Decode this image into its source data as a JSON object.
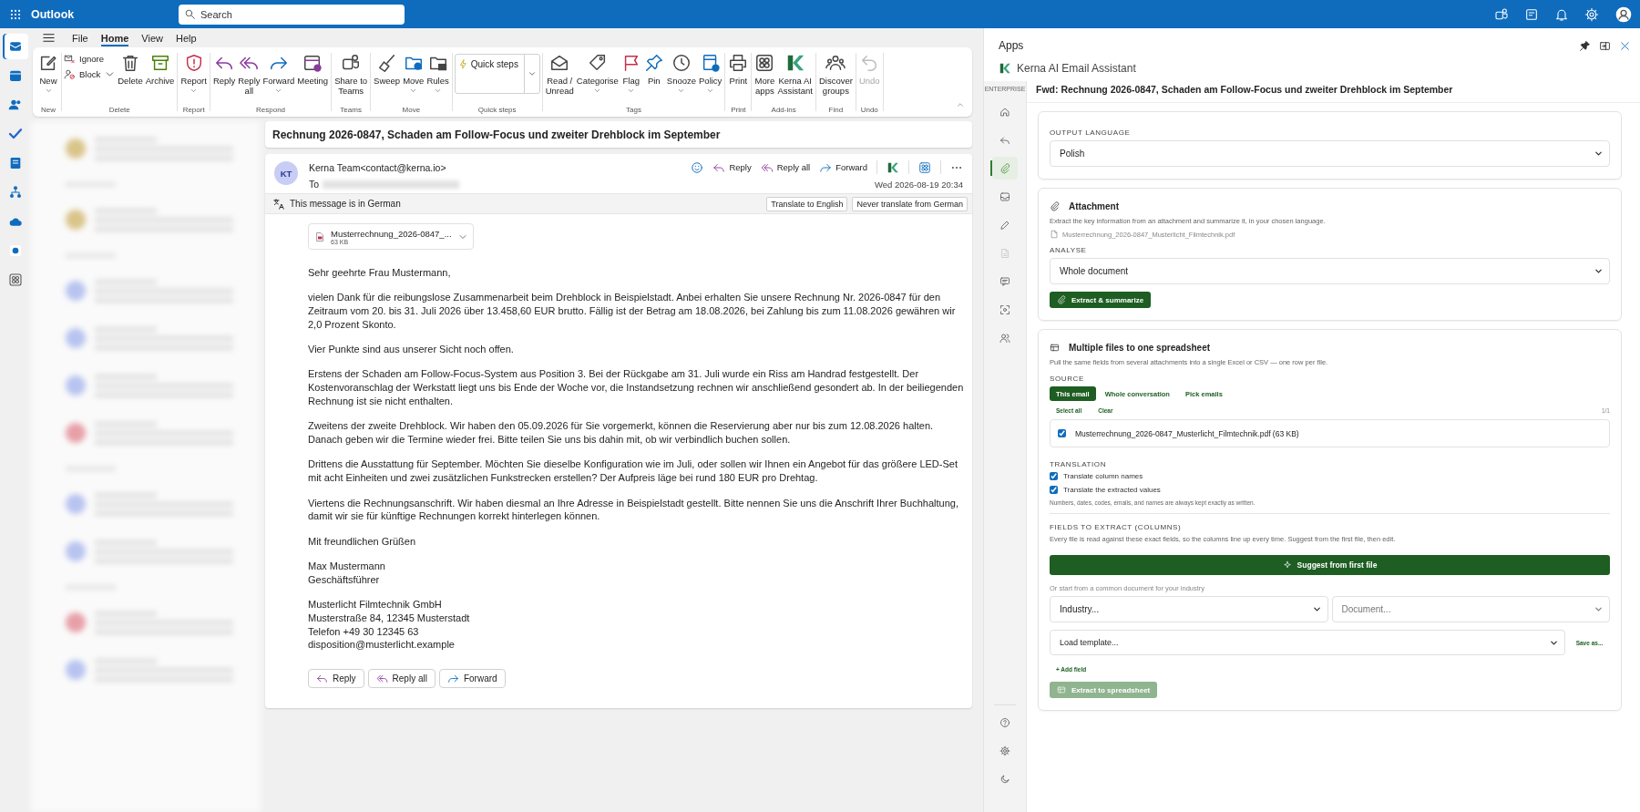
{
  "top_bar": {
    "app_name": "Outlook",
    "search": {
      "placeholder": "Search"
    }
  },
  "app_rail": [
    {
      "selected": true
    },
    {
      "selected": false
    },
    {
      "selected": false
    },
    {
      "selected": false
    },
    {
      "selected": false
    },
    {
      "selected": false
    },
    {
      "selected": false
    },
    {
      "selected": false
    },
    {
      "selected": false
    }
  ],
  "menu_tabs": [
    {
      "label": "File",
      "selected": false
    },
    {
      "label": "Home",
      "selected": true
    },
    {
      "label": "View",
      "selected": false
    },
    {
      "label": "Help",
      "selected": false
    }
  ],
  "ribbon": {
    "groups": [
      {
        "label": "New",
        "buttons": [
          {
            "label": "New",
            "kind": "new",
            "dropdown": true,
            "disabled": false
          }
        ]
      },
      {
        "label": "Delete",
        "small": [
          {
            "label": "Ignore",
            "kind": "ignore",
            "dropdown": false
          },
          {
            "label": "Block",
            "kind": "block",
            "dropdown": true
          }
        ],
        "buttons": [
          {
            "label": "Delete",
            "kind": "delete",
            "dropdown": false,
            "disabled": false
          },
          {
            "label": "Archive",
            "kind": "archive",
            "dropdown": false,
            "disabled": false
          }
        ]
      },
      {
        "label": "Report",
        "buttons": [
          {
            "label": "Report",
            "kind": "report",
            "dropdown": true,
            "disabled": false
          }
        ]
      },
      {
        "label": "Respond",
        "buttons": [
          {
            "label": "Reply",
            "kind": "reply",
            "dropdown": false,
            "disabled": false
          },
          {
            "label": "Reply\nall",
            "kind": "replyall",
            "dropdown": false,
            "disabled": false
          },
          {
            "label": "Forward",
            "kind": "forward",
            "dropdown": true,
            "disabled": false
          },
          {
            "label": "Meeting",
            "kind": "meeting",
            "dropdown": false,
            "disabled": false
          }
        ]
      },
      {
        "label": "Teams",
        "buttons": [
          {
            "label": "Share to\nTeams",
            "kind": "teams",
            "dropdown": false,
            "disabled": false
          }
        ]
      },
      {
        "label": "Move",
        "buttons": [
          {
            "label": "Sweep",
            "kind": "sweep",
            "dropdown": false,
            "disabled": false
          },
          {
            "label": "Move",
            "kind": "move",
            "dropdown": true,
            "disabled": false
          },
          {
            "label": "Rules",
            "kind": "rules",
            "dropdown": true,
            "disabled": false
          }
        ]
      },
      {
        "label": "Quick steps",
        "quick_steps": {
          "label": "Quick steps"
        }
      },
      {
        "label": "Tags",
        "buttons": [
          {
            "label": "Read /\nUnread",
            "kind": "read",
            "dropdown": false,
            "disabled": false
          },
          {
            "label": "Categorise",
            "kind": "categorise",
            "dropdown": true,
            "disabled": false
          },
          {
            "label": "Flag",
            "kind": "flag",
            "dropdown": true,
            "disabled": false
          },
          {
            "label": "Pin",
            "kind": "pin",
            "dropdown": false,
            "disabled": false
          },
          {
            "label": "Snooze",
            "kind": "snooze",
            "dropdown": true,
            "disabled": false
          },
          {
            "label": "Policy",
            "kind": "policy",
            "dropdown": true,
            "disabled": false
          }
        ]
      },
      {
        "label": "Print",
        "buttons": [
          {
            "label": "Print",
            "kind": "print",
            "dropdown": false,
            "disabled": false
          }
        ]
      },
      {
        "label": "Add-ins",
        "buttons": [
          {
            "label": "More\napps",
            "kind": "apps",
            "dropdown": false,
            "disabled": false
          },
          {
            "label": "Kerna AI\nAssistant",
            "kind": "kerna",
            "dropdown": false,
            "disabled": false
          }
        ]
      },
      {
        "label": "Find",
        "buttons": [
          {
            "label": "Discover\ngroups",
            "kind": "groups",
            "dropdown": false,
            "disabled": false
          }
        ]
      },
      {
        "label": "Undo",
        "buttons": [
          {
            "label": "Undo",
            "kind": "undo",
            "dropdown": false,
            "disabled": true
          }
        ]
      }
    ]
  },
  "reading_pane": {
    "subject": "Rechnung 2026-0847, Schaden am Follow-Focus und zweiter Drehblock im September",
    "message": {
      "avatar_initials": "KT",
      "sender": "Kerna Team<contact@kerna.io>",
      "to_label": "To",
      "date": "Wed 2026-08-19 20:34",
      "actions": [
        {
          "label": "Reply",
          "kind": "reply"
        },
        {
          "label": "Reply all",
          "kind": "replyall"
        },
        {
          "label": "Forward",
          "kind": "forward"
        }
      ],
      "translation_bar": {
        "text": "This message is in German",
        "buttons": [
          "Translate to English",
          "Never translate from German"
        ]
      },
      "attachment": {
        "name": "Musterrechnung_2026-0847_...",
        "size": "63 KB"
      },
      "body": [
        [
          "Sehr geehrte Frau Mustermann,"
        ],
        [
          "vielen Dank für die reibungslose Zusammenarbeit beim Drehblock in Beispielstadt. Anbei erhalten Sie unsere Rechnung Nr. 2026-0847 für den Zeitraum vom 20. bis 31. Juli 2026 über 13.458,60 EUR brutto. Fällig ist der Betrag am 18.08.2026, bei Zahlung bis zum 11.08.2026 gewähren wir 2,0 Prozent Skonto."
        ],
        [
          "Vier Punkte sind aus unserer Sicht noch offen."
        ],
        [
          "Erstens der Schaden am Follow-Focus-System aus Position 3. Bei der Rückgabe am 31. Juli wurde ein Riss am Handrad festgestellt. Der Kostenvoranschlag der Werkstatt liegt uns bis Ende der Woche vor, die Instandsetzung rechnen wir anschließend gesondert ab. In der beiliegenden Rechnung ist sie nicht enthalten."
        ],
        [
          "Zweitens der zweite Drehblock. Wir haben den 05.09.2026 für Sie vorgemerkt, können die Reservierung aber nur bis zum 12.08.2026 halten. Danach geben wir die Termine wieder frei. Bitte teilen Sie uns bis dahin mit, ob wir verbindlich buchen sollen."
        ],
        [
          "Drittens die Ausstattung für September. Möchten Sie dieselbe Konfiguration wie im Juli, oder sollen wir Ihnen ein Angebot für das größere LED-Set mit acht Einheiten und zwei zusätzlichen Funkstrecken erstellen? Der Aufpreis läge bei rund 180 EUR pro Drehtag."
        ],
        [
          "Viertens die Rechnungsanschrift. Wir haben diesmal an Ihre Adresse in Beispielstadt gestellt. Bitte nennen Sie uns die Anschrift Ihrer Buchhaltung, damit wir sie für künftige Rechnungen korrekt hinterlegen können."
        ],
        [
          "Mit freundlichen Grüßen"
        ],
        [
          "Max Mustermann",
          "Geschäftsführer"
        ],
        [
          "Musterlicht Filmtechnik GmbH",
          "Musterstraße 84, 12345 Musterstadt",
          "Telefon +49 30 12345 63",
          "disposition@musterlicht.example"
        ]
      ],
      "footer_buttons": [
        {
          "label": "Reply",
          "kind": "reply"
        },
        {
          "label": "Reply all",
          "kind": "replyall"
        },
        {
          "label": "Forward",
          "kind": "forward"
        }
      ]
    }
  },
  "add_in": {
    "title": "Apps",
    "name": "Kerna AI Email Assistant",
    "sidebar": {
      "label": "ENTERPRISE",
      "items": [
        {
          "kind": "home",
          "selected": false,
          "disabled": false
        },
        {
          "kind": "reply",
          "selected": false,
          "disabled": false
        },
        {
          "kind": "attachment",
          "selected": true,
          "disabled": false
        },
        {
          "kind": "inbox",
          "selected": false,
          "disabled": false
        },
        {
          "kind": "compose",
          "selected": false,
          "disabled": false
        },
        {
          "kind": "document",
          "selected": false,
          "disabled": true
        },
        {
          "kind": "chat",
          "selected": false,
          "disabled": false
        },
        {
          "kind": "scan",
          "selected": false,
          "disabled": false
        },
        {
          "kind": "team",
          "selected": false,
          "disabled": false
        }
      ],
      "bottom": [
        {
          "kind": "help"
        },
        {
          "kind": "settings"
        },
        {
          "kind": "theme"
        }
      ]
    },
    "email_subject": "Fwd: Rechnung 2026-0847, Schaden am Follow-Focus und zweiter Drehblock im September",
    "output_language": {
      "label": "OUTPUT LANGUAGE",
      "value": "Polish"
    },
    "attachment_card": {
      "title": "Attachment",
      "description": "Extract the key information from an attachment and summarize it, in your chosen language.",
      "file": "Musterrechnung_2026-0847_Musterlicht_Filmtechnik.pdf",
      "analyse_label": "ANALYSE",
      "analyse_value": "Whole document",
      "button": "Extract & summarize"
    },
    "spreadsheet_card": {
      "title": "Multiple files to one spreadsheet",
      "description": "Pull the same fields from several attachments into a single Excel or CSV — one row per file.",
      "source_label": "SOURCE",
      "sources": [
        {
          "label": "This email",
          "selected": true
        },
        {
          "label": "Whole conversation",
          "selected": false
        },
        {
          "label": "Pick emails",
          "selected": false
        }
      ],
      "select_all": "Select all",
      "clear": "Clear",
      "count": "1/1",
      "files": [
        {
          "name": "Musterrechnung_2026-0847_Musterlicht_Filmtechnik.pdf (63 KB)",
          "checked": true
        }
      ],
      "translation_label": "TRANSLATION",
      "translation_options": [
        {
          "label": "Translate column names",
          "checked": true
        },
        {
          "label": "Translate the extracted values",
          "checked": true
        }
      ],
      "translation_note": "Numbers, dates, codes, emails, and names are always kept exactly as written.",
      "fields_label": "FIELDS TO EXTRACT (COLUMNS)",
      "fields_description": "Every file is read against these exact fields, so the columns line up every time. Suggest from the first file, then edit.",
      "suggest_button": "Suggest from first file",
      "industry_hint": "Or start from a common document for your industry",
      "industry_select": {
        "value": "Industry...",
        "disabled": false
      },
      "document_select": {
        "value": "Document...",
        "disabled": true
      },
      "template_select": {
        "value": "Load template...",
        "disabled": false
      },
      "save_as": "Save as...",
      "add_field": "+ Add field",
      "extract_button": {
        "label": "Extract to spreadsheet",
        "disabled": true
      }
    }
  }
}
